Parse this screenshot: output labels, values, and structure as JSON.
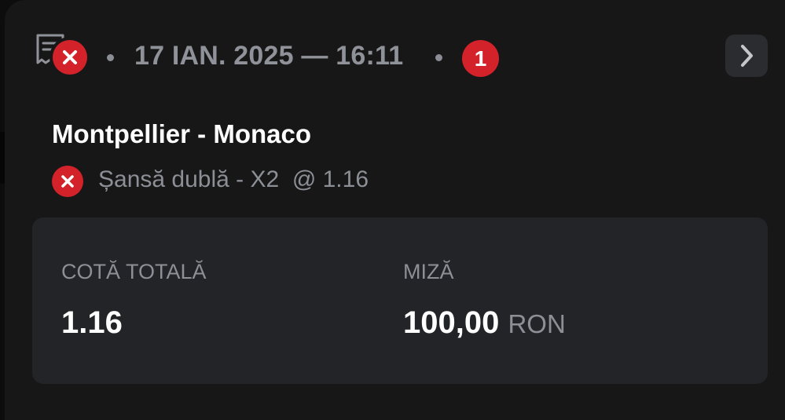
{
  "header": {
    "date_time": "17 IAN. 2025 — 16:11",
    "selections_count": "1"
  },
  "event": {
    "match": "Montpellier - Monaco",
    "selection": "Șansă dublă - X2  @ 1.16"
  },
  "summary": {
    "total_odds_label": "COTĂ TOTALĂ",
    "total_odds_value": "1.16",
    "stake_label": "MIZĂ",
    "stake_value": "100,00",
    "stake_currency": "RON"
  },
  "status": {
    "result": "lost",
    "color": "#d3222a"
  },
  "icons": {
    "ticket": "receipt-icon",
    "result": "close-icon",
    "navigate": "chevron-right-icon"
  }
}
